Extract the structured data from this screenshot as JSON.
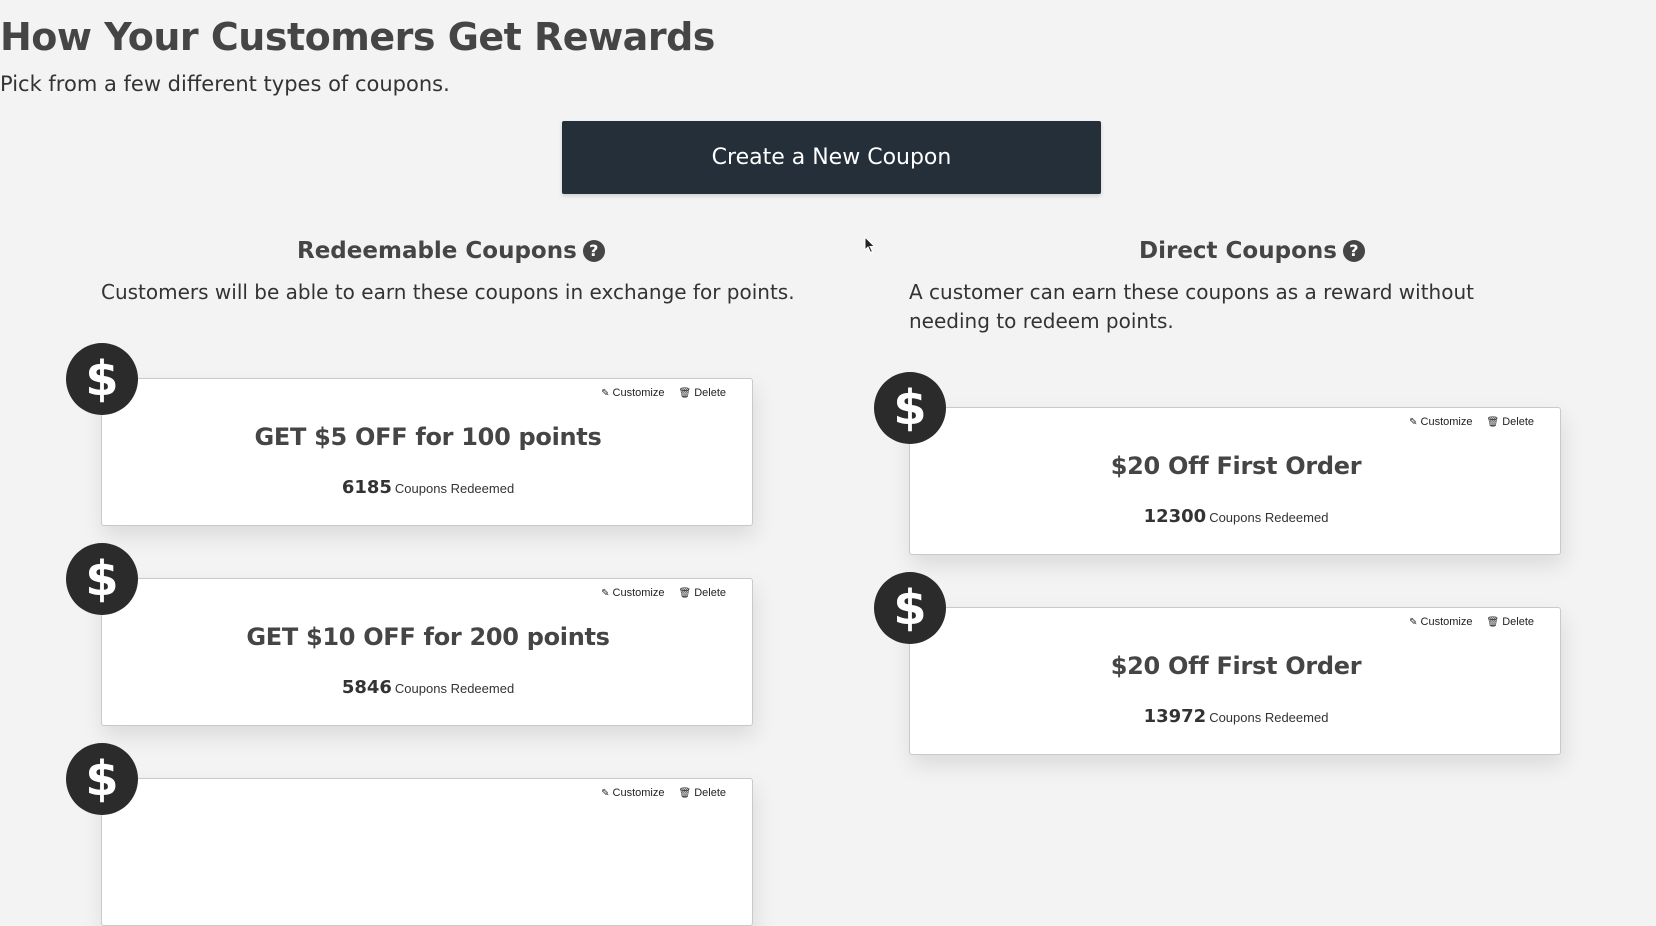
{
  "header": {
    "title": "How Your Customers Get Rewards",
    "subtitle": "Pick from a few different types of coupons.",
    "create_button_label": "Create a New Coupon"
  },
  "redeemable": {
    "title": "Redeemable Coupons",
    "description": "Customers will be able to earn these coupons in exchange for points.",
    "coupons": [
      {
        "name": "GET $5 OFF for 100 points",
        "count": "6185",
        "count_label": "Coupons Redeemed",
        "customize_label": "Customize",
        "delete_label": "Delete"
      },
      {
        "name": "GET $10 OFF for 200 points",
        "count": "5846",
        "count_label": "Coupons Redeemed",
        "customize_label": "Customize",
        "delete_label": "Delete"
      },
      {
        "name": "",
        "count": "",
        "count_label": "",
        "customize_label": "Customize",
        "delete_label": "Delete"
      }
    ]
  },
  "direct": {
    "title": "Direct Coupons",
    "description": "A customer can earn these coupons as a reward without needing to redeem points.",
    "coupons": [
      {
        "name": "$20 Off First Order",
        "count": "12300",
        "count_label": "Coupons Redeemed",
        "customize_label": "Customize",
        "delete_label": "Delete"
      },
      {
        "name": "$20 Off First Order",
        "count": "13972",
        "count_label": "Coupons Redeemed",
        "customize_label": "Customize",
        "delete_label": "Delete"
      }
    ]
  },
  "icons": {
    "badge_symbol": "$",
    "help_symbol": "?",
    "customize_icon": "pencil-icon",
    "delete_icon": "trash-icon"
  },
  "colors": {
    "background": "#f3f3f4",
    "button_bg": "#252f39",
    "badge_bg": "#2b2b2b",
    "heading": "#454545"
  }
}
